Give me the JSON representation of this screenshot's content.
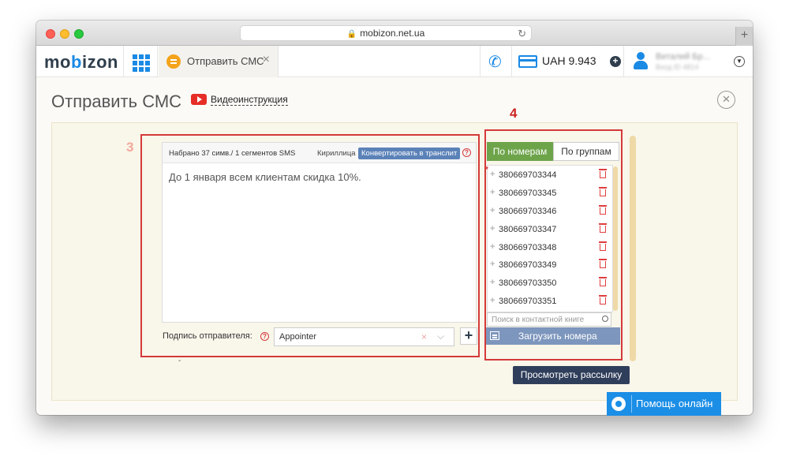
{
  "browser": {
    "url": "mobizon.net.ua"
  },
  "header": {
    "logo": {
      "pre": "mo",
      "accent": "b",
      "post": "izon"
    },
    "tab_label": "Отправить СМС",
    "balance": "UAH 9.943",
    "user_name": "Виталий Бр...",
    "user_sub": "Вход ID 4814"
  },
  "page": {
    "title": "Отправить СМС",
    "video_link": "Видеоинструкция"
  },
  "annotations": {
    "marker3": "3",
    "marker4": "4"
  },
  "message": {
    "counter": "Набрано 37 симв./ 1 сегментов SMS",
    "charset": "Кириллица",
    "translit_button": "Конвертировать в транслит",
    "text": "До 1 января всем клиентам скидка 10%."
  },
  "sender": {
    "label": "Подпись отправителя:",
    "value": "Appointer"
  },
  "recipients": {
    "tab_numbers": "По номерам",
    "tab_groups": "По группам",
    "numbers": [
      "380669703344",
      "380669703345",
      "380669703346",
      "380669703347",
      "380669703348",
      "380669703349",
      "380669703350",
      "380669703351"
    ],
    "search_placeholder": "Поиск в контактной книге",
    "upload_button": "Загрузить номера"
  },
  "preview_button": "Просмотреть рассылку",
  "help_button": "Помощь онлайн",
  "colors": {
    "brand_blue": "#1a8ae5",
    "active_tab_green": "#6da44a",
    "annotation_red": "#d43a3a"
  }
}
